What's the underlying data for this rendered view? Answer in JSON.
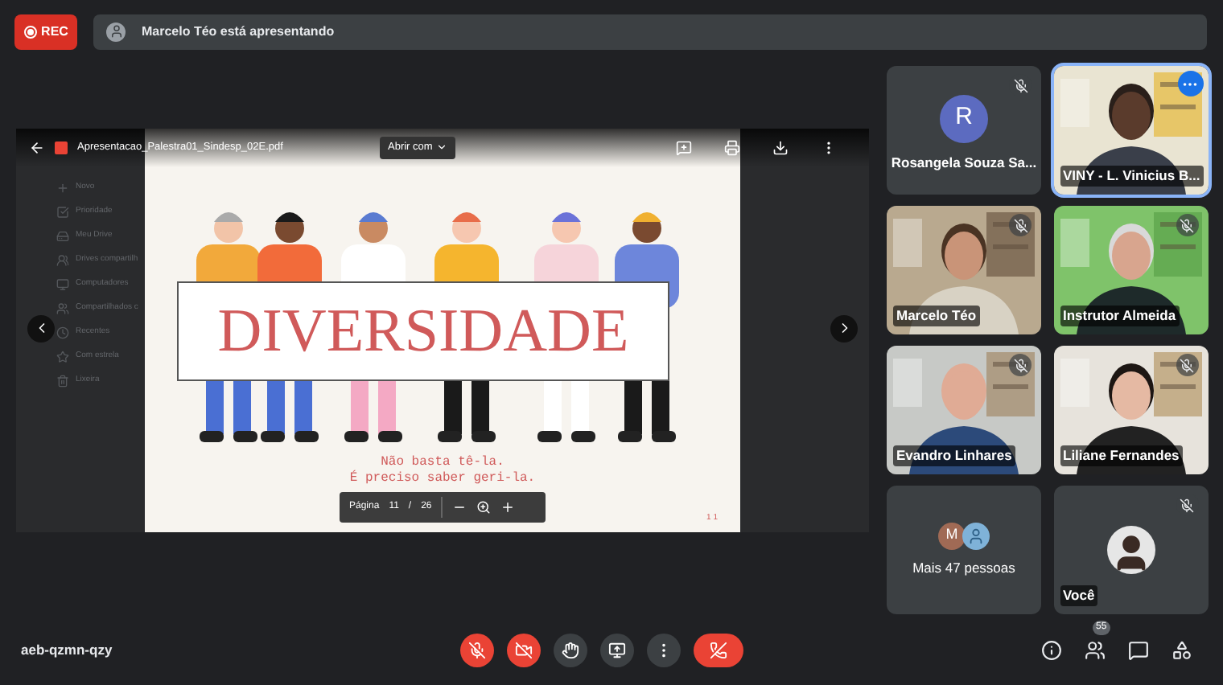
{
  "recording": {
    "label": "REC",
    "on": true
  },
  "presenter_banner": {
    "text": "Marcelo Téo está apresentando"
  },
  "presentation": {
    "file_name": "Apresentacao_Palestra01_Sindesp_02E.pdf",
    "open_with": "Abrir com",
    "drive_sidebar": [
      "Novo",
      "Prioridade",
      "Meu Drive",
      "Drives compartilh",
      "Computadores",
      "Compartilhados c",
      "Recentes",
      "Com estrela",
      "Lixeira"
    ],
    "slide": {
      "title": "DIVERSIDADE",
      "caption_lines": [
        "Não basta tê-la.",
        "É preciso saber geri-la."
      ],
      "page_mark": "1 1"
    },
    "pager": {
      "label": "Página",
      "current": "11",
      "separator": "/",
      "total": "26"
    }
  },
  "participants": [
    {
      "kind": "avatar",
      "name": "Rosangela Souza Sa...",
      "initial": "R",
      "muted": true,
      "selected": false
    },
    {
      "kind": "video",
      "name": "VINY - L. Vinicius B...",
      "muted": false,
      "selected": true
    },
    {
      "kind": "video",
      "name": "Marcelo Téo",
      "muted": true,
      "selected": false
    },
    {
      "kind": "video",
      "name": "Instrutor Almeida",
      "muted": true,
      "selected": false
    },
    {
      "kind": "video",
      "name": "Evandro Linhares",
      "muted": true,
      "selected": false
    },
    {
      "kind": "video",
      "name": "Liliane Fernandes",
      "muted": true,
      "selected": false
    },
    {
      "kind": "others",
      "name": "Mais 47 pessoas",
      "initial": "M",
      "selected": false
    },
    {
      "kind": "self",
      "name": "Você",
      "muted": true,
      "selected": false
    }
  ],
  "meeting_code": "aeb-qzmn-qzy",
  "controls": [
    {
      "kind": "mic",
      "on": false
    },
    {
      "kind": "camera",
      "on": false
    },
    {
      "kind": "hand"
    },
    {
      "kind": "present"
    },
    {
      "kind": "more"
    },
    {
      "kind": "leave"
    }
  ],
  "side_controls": [
    {
      "kind": "info"
    },
    {
      "kind": "people",
      "badge": "55"
    },
    {
      "kind": "chat"
    },
    {
      "kind": "activities"
    }
  ]
}
